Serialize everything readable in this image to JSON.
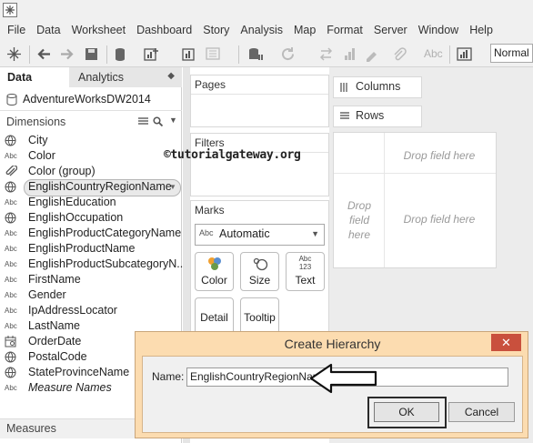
{
  "menu": [
    "File",
    "Data",
    "Worksheet",
    "Dashboard",
    "Story",
    "Analysis",
    "Map",
    "Format",
    "Server",
    "Window",
    "Help"
  ],
  "toolbar": {
    "format_label": "Abc",
    "view_size": "Normal"
  },
  "left_pane": {
    "tab_data": "Data",
    "tab_analytics": "Analytics",
    "datasource": "AdventureWorksDW2014",
    "dimensions_header": "Dimensions",
    "fields": [
      {
        "icon": "globe-icon",
        "name": "City"
      },
      {
        "icon": "abc-icon",
        "name": "Color"
      },
      {
        "icon": "paperclip-icon",
        "name": "Color (group)"
      },
      {
        "icon": "globe-icon",
        "name": "EnglishCountryRegionName",
        "selected": true
      },
      {
        "icon": "abc-icon",
        "name": "EnglishEducation"
      },
      {
        "icon": "globe-icon",
        "name": "EnglishOccupation"
      },
      {
        "icon": "abc-icon",
        "name": "EnglishProductCategoryName"
      },
      {
        "icon": "abc-icon",
        "name": "EnglishProductName"
      },
      {
        "icon": "abc-icon",
        "name": "EnglishProductSubcategoryN..."
      },
      {
        "icon": "abc-icon",
        "name": "FirstName"
      },
      {
        "icon": "abc-icon",
        "name": "Gender"
      },
      {
        "icon": "abc-icon",
        "name": "IpAddressLocator"
      },
      {
        "icon": "abc-icon",
        "name": "LastName"
      },
      {
        "icon": "calendar-icon",
        "name": "OrderDate"
      },
      {
        "icon": "globe-icon",
        "name": "PostalCode"
      },
      {
        "icon": "globe-icon",
        "name": "StateProvinceName"
      },
      {
        "icon": "abc-icon",
        "name": "Measure Names",
        "italic": true
      }
    ],
    "measures_header": "Measures"
  },
  "cards": {
    "pages": "Pages",
    "filters": "Filters",
    "marks": "Marks",
    "marks_type": "Automatic",
    "marks_buttons": [
      "Color",
      "Size",
      "Text",
      "Detail",
      "Tooltip"
    ],
    "text_glyph": "Abc\n123"
  },
  "shelves": {
    "columns": "Columns",
    "rows": "Rows"
  },
  "canvas": {
    "drop_top": "Drop field here",
    "drop_left": "Drop\nfield\nhere",
    "drop_center": "Drop field here"
  },
  "watermark": "©tutorialgateway.org",
  "dialog": {
    "title": "Create Hierarchy",
    "close": "✕",
    "name_label": "Name:",
    "name_value": "EnglishCountryRegionName",
    "ok": "OK",
    "cancel": "Cancel"
  }
}
